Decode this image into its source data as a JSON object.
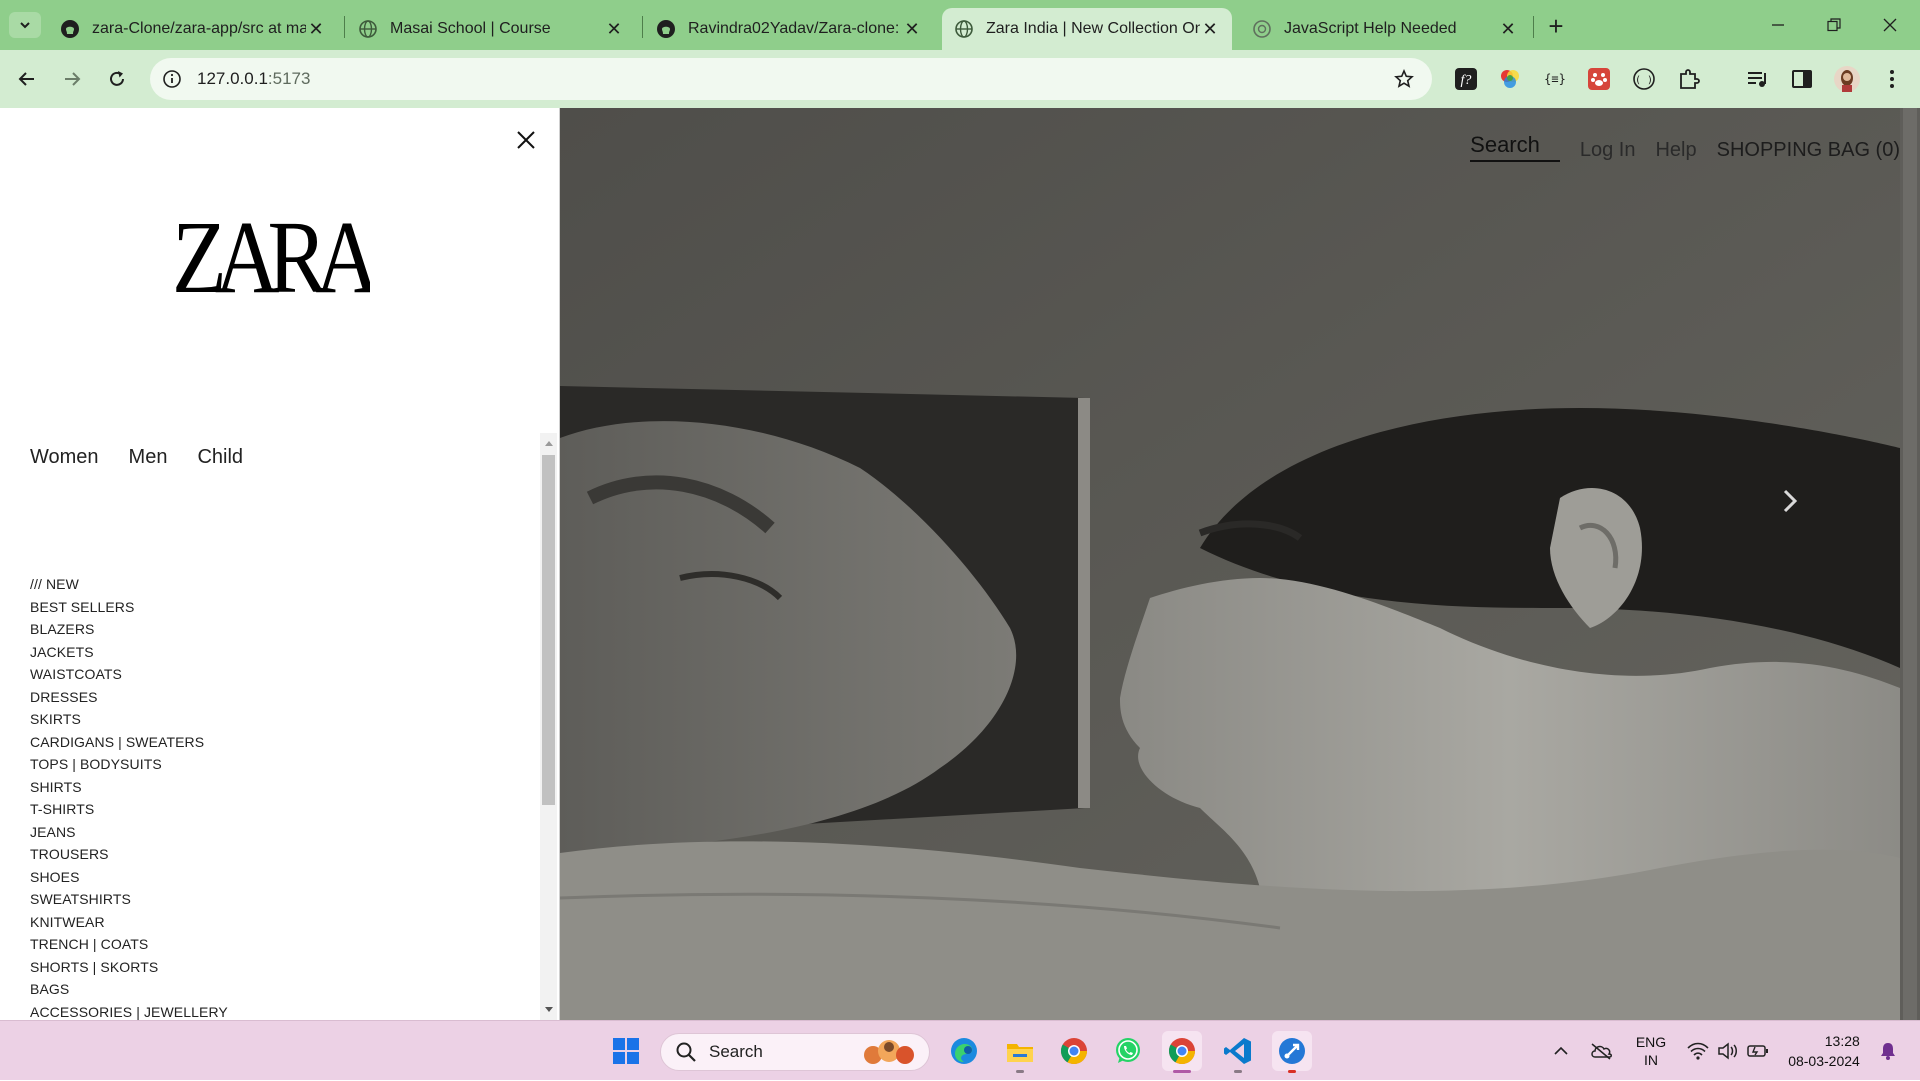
{
  "browser": {
    "tabs": [
      {
        "title": "zara-Clone/zara-app/src at main",
        "favicon": "github-icon",
        "active": false
      },
      {
        "title": "Masai School | Course",
        "favicon": "globe-icon",
        "active": false
      },
      {
        "title": "Ravindra02Yadav/Zara-clone: Th",
        "favicon": "github-icon",
        "active": false
      },
      {
        "title": "Zara India | New Collection On",
        "favicon": "globe-icon",
        "active": true
      },
      {
        "title": "JavaScript Help Needed",
        "favicon": "chatgpt-icon",
        "active": false
      }
    ],
    "url_host": "127.0.0.1",
    "url_port": ":5173"
  },
  "sidebar": {
    "logo_text": "ZARA",
    "gender_tabs": [
      "Women",
      "Men",
      "Child"
    ],
    "categories": [
      "/// NEW",
      "BEST SELLERS",
      "BLAZERS",
      "JACKETS",
      "WAISTCOATS",
      "DRESSES",
      "SKIRTS",
      "CARDIGANS | SWEATERS",
      "TOPS | BODYSUITS",
      "SHIRTS",
      "T-SHIRTS",
      "JEANS",
      "TROUSERS",
      "SHOES",
      "SWEATSHIRTS",
      "KNITWEAR",
      "TRENCH | COATS",
      "SHORTS | SKORTS",
      "BAGS",
      "ACCESSORIES | JEWELLERY"
    ]
  },
  "header": {
    "search_label": "Search",
    "login_label": "Log In",
    "help_label": "Help",
    "bag_label": "SHOPPING BAG (0)"
  },
  "taskbar": {
    "search_placeholder": "Search",
    "lang_top": "ENG",
    "lang_bottom": "IN",
    "time": "13:28",
    "date": "08-03-2024"
  },
  "colors": {
    "chrome_frame": "#8fce8b",
    "chrome_toolbar": "#d3ecd1",
    "taskbar": "#ecd1e5"
  }
}
